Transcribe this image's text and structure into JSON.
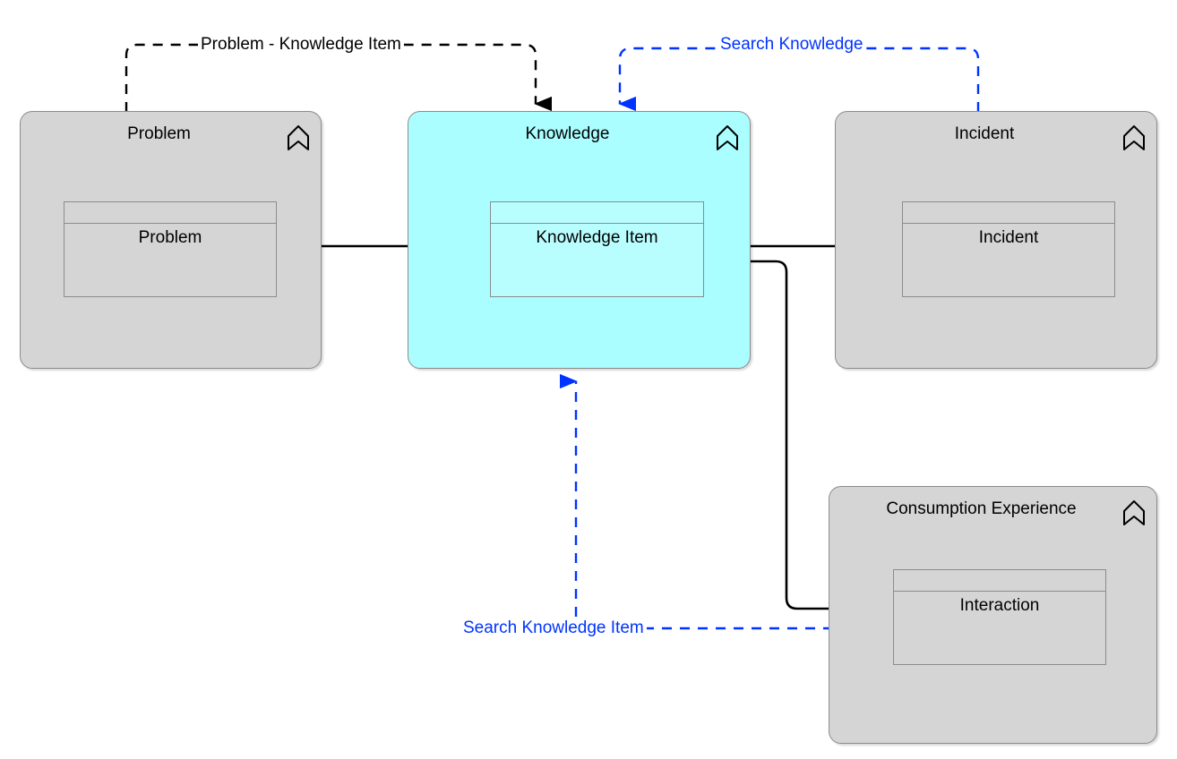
{
  "diagram": {
    "type": "archimate-grouping-diagram",
    "background": "#ffffff",
    "colors": {
      "grouping_gray_fill": "#d5d5d5",
      "grouping_highlight_fill": "#aafeff",
      "border": "#8c8c8c",
      "relation_black": "#000000",
      "relation_blue": "#0033ff"
    }
  },
  "groupings": [
    {
      "id": "problem",
      "title": "Problem",
      "fill": "#d5d5d5",
      "icon": "grouping-chevron-icon",
      "element": {
        "label": "Problem",
        "fill": "#d5d5d5"
      }
    },
    {
      "id": "knowledge",
      "title": "Knowledge",
      "fill": "#aafeff",
      "icon": "grouping-chevron-icon",
      "element": {
        "label": "Knowledge Item",
        "fill": "#b9feff"
      }
    },
    {
      "id": "incident",
      "title": "Incident",
      "fill": "#d5d5d5",
      "icon": "grouping-chevron-icon",
      "element": {
        "label": "Incident",
        "fill": "#d5d5d5"
      }
    },
    {
      "id": "consumption-experience",
      "title": "Consumption Experience",
      "fill": "#d5d5d5",
      "icon": "grouping-chevron-icon",
      "element": {
        "label": "Interaction",
        "fill": "#d5d5d5"
      }
    }
  ],
  "relations": [
    {
      "id": "problem-knowledge-item",
      "label": "Problem - Knowledge Item",
      "style": "dashed",
      "color": "#000000",
      "from": "Problem",
      "to": "Knowledge",
      "arrowhead": true
    },
    {
      "id": "search-knowledge",
      "label": "Search Knowledge",
      "style": "dashed",
      "color": "#0033ff",
      "from": "Incident",
      "to": "Knowledge",
      "arrowhead": true
    },
    {
      "id": "search-knowledge-item",
      "label": "Search Knowledge Item",
      "style": "dashed",
      "color": "#0033ff",
      "from": "Interaction",
      "to": "Knowledge",
      "arrowhead": true
    },
    {
      "id": "problem-to-knowledge-item",
      "label": "",
      "style": "solid",
      "color": "#000000",
      "from": "Problem",
      "to": "Knowledge Item",
      "arrowhead": false
    },
    {
      "id": "knowledge-item-to-incident",
      "label": "",
      "style": "solid",
      "color": "#000000",
      "from": "Knowledge Item",
      "to": "Incident",
      "arrowhead": false
    },
    {
      "id": "knowledge-item-to-interaction",
      "label": "",
      "style": "solid",
      "color": "#000000",
      "from": "Knowledge Item",
      "to": "Interaction",
      "arrowhead": false
    }
  ]
}
